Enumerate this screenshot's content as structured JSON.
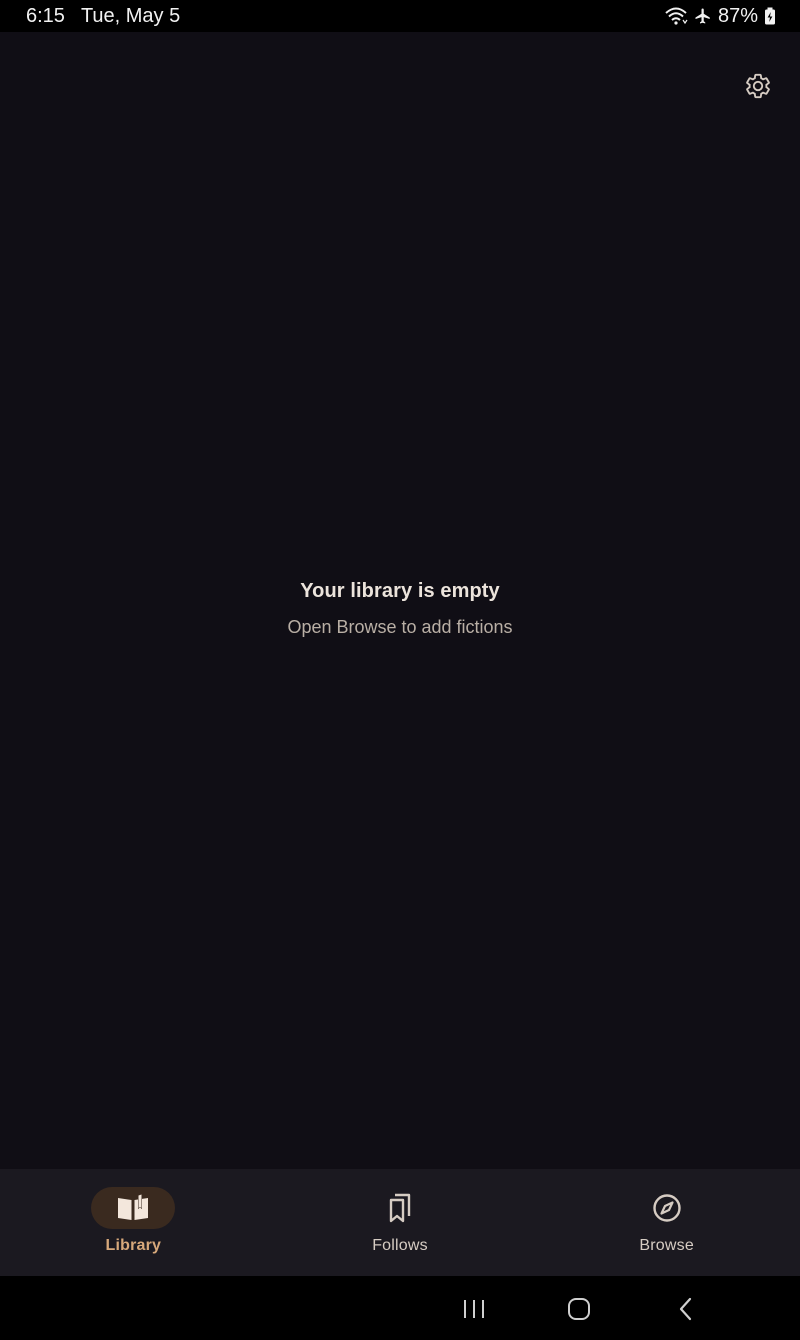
{
  "status_bar": {
    "time": "6:15",
    "date": "Tue, May 5",
    "battery": "87%"
  },
  "empty_state": {
    "title": "Your library is empty",
    "subtitle": "Open Browse to add fictions"
  },
  "bottom_nav": {
    "items": [
      {
        "label": "Library",
        "icon": "book-open-icon",
        "active": true
      },
      {
        "label": "Follows",
        "icon": "bookmarks-icon",
        "active": false
      },
      {
        "label": "Browse",
        "icon": "compass-icon",
        "active": false
      }
    ]
  },
  "colors": {
    "background": "#100e15",
    "nav_background": "#1b1920",
    "accent": "#d7a87b",
    "accent_pill": "#3a2a1f"
  }
}
